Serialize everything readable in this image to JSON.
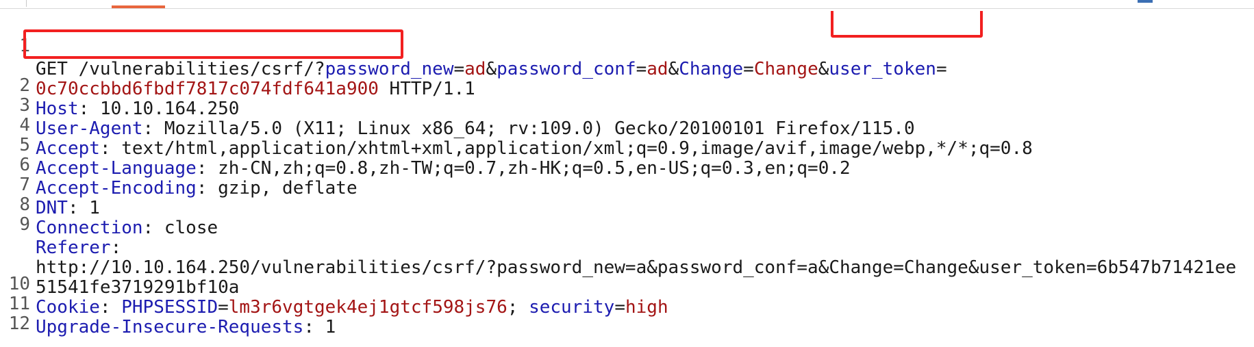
{
  "request": {
    "lines": [
      {
        "num": "1",
        "method": "GET /vulnerabilities/csrf/?",
        "k1": "password_new",
        "eq1": "=",
        "v1": "ad",
        "amp1": "&",
        "k2": "password_conf",
        "eq2": "=",
        "v2": "ad",
        "amp2": "&",
        "k3": "Change",
        "eq3": "=",
        "v3": "Change",
        "amp3": "&",
        "k4": "user_token",
        "eq4": "="
      },
      {
        "num": "",
        "token": "0c70ccbbd6fbdf7817c074fdf641a900",
        "proto": " HTTP/1.1"
      },
      {
        "num": "2",
        "name": "Host",
        "sep": ": ",
        "value": "10.10.164.250"
      },
      {
        "num": "3",
        "name": "User-Agent",
        "sep": ": ",
        "value": "Mozilla/5.0 (X11; Linux x86_64; rv:109.0) Gecko/20100101 Firefox/115.0"
      },
      {
        "num": "4",
        "name": "Accept",
        "sep": ": ",
        "value": "text/html,application/xhtml+xml,application/xml;q=0.9,image/avif,image/webp,*/*;q=0.8"
      },
      {
        "num": "5",
        "name": "Accept-Language",
        "sep": ": ",
        "value": "zh-CN,zh;q=0.8,zh-TW;q=0.7,zh-HK;q=0.5,en-US;q=0.3,en;q=0.2"
      },
      {
        "num": "6",
        "name": "Accept-Encoding",
        "sep": ": ",
        "value": "gzip, deflate"
      },
      {
        "num": "7",
        "name": "DNT",
        "sep": ": ",
        "value": "1"
      },
      {
        "num": "8",
        "name": "Connection",
        "sep": ": ",
        "value": "close"
      },
      {
        "num": "9",
        "name": "Referer",
        "sep": ":",
        "value": ""
      },
      {
        "num": "",
        "text": "http://10.10.164.250/vulnerabilities/csrf/?password_new=a&password_conf=a&Change=Change&user_token=6b547b71421ee"
      },
      {
        "num": "",
        "text": "51541fe3719291bf10a"
      },
      {
        "num": "10",
        "name": "Cookie",
        "sep": ": ",
        "ck1": "PHPSESSID",
        "ceq1": "=",
        "cv1": "lm3r6vgtgek4ej1gtcf598js76",
        "csep": "; ",
        "ck2": "security",
        "ceq2": "=",
        "cv2": "high"
      },
      {
        "num": "11",
        "name": "Upgrade-Insecure-Requests",
        "sep": ": ",
        "value": "1"
      },
      {
        "num": "12"
      }
    ]
  },
  "colors": {
    "header_name": "#1c1cb0",
    "param_value": "#a31515",
    "highlight_box": "#f22020",
    "tab_accent": "#e8663d"
  }
}
